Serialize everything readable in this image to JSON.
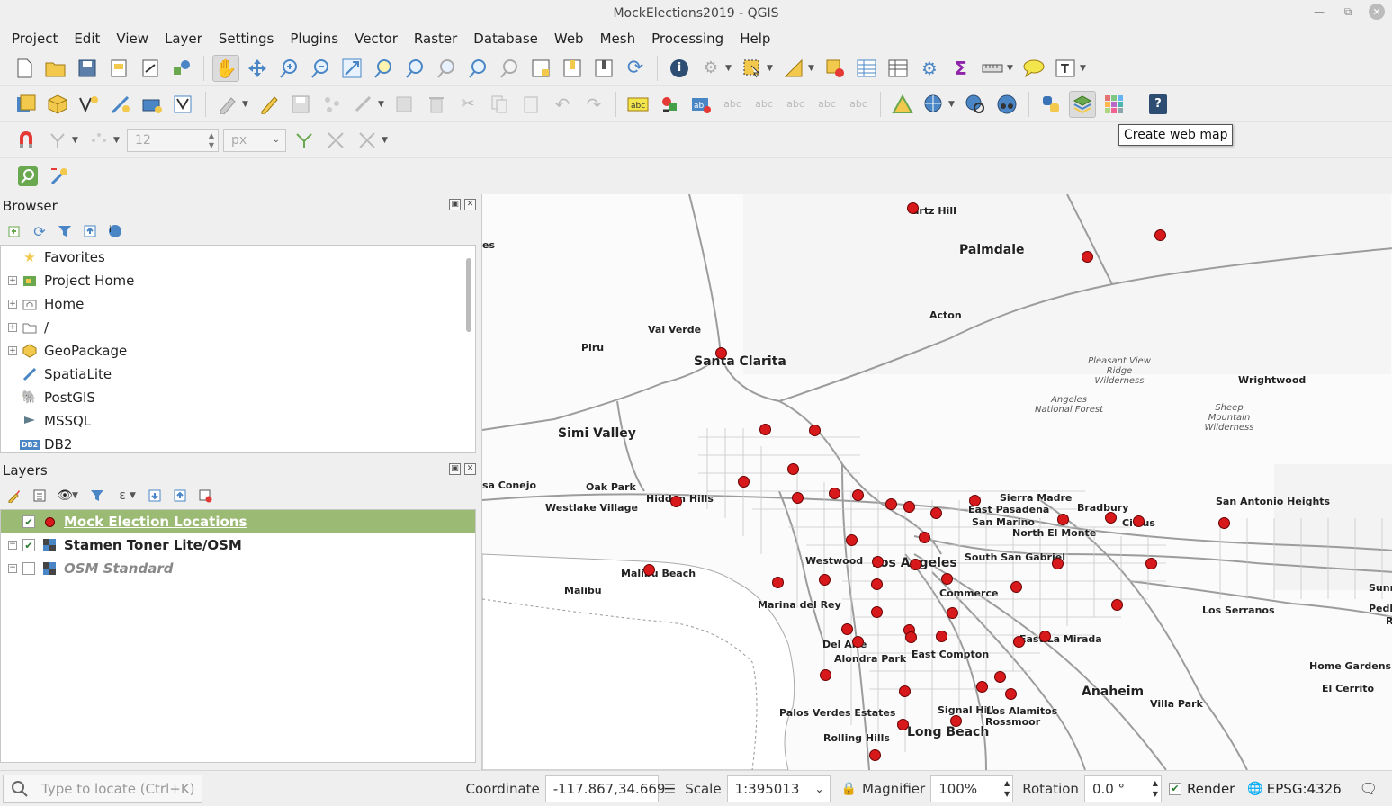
{
  "window": {
    "title": "MockElections2019 - QGIS"
  },
  "menu": [
    "Project",
    "Edit",
    "View",
    "Layer",
    "Settings",
    "Plugins",
    "Vector",
    "Raster",
    "Database",
    "Web",
    "Mesh",
    "Processing",
    "Help"
  ],
  "snapping": {
    "tolerance": "12",
    "unit": "px"
  },
  "tooltip": "Create web map",
  "browser": {
    "title": "Browser",
    "items": [
      {
        "label": "Favorites",
        "expandable": false,
        "icon": "star-icon"
      },
      {
        "label": "Project Home",
        "expandable": true,
        "icon": "project-home-icon"
      },
      {
        "label": "Home",
        "expandable": true,
        "icon": "home-icon"
      },
      {
        "label": "/",
        "expandable": true,
        "icon": "folder-icon"
      },
      {
        "label": "GeoPackage",
        "expandable": true,
        "icon": "geopackage-icon"
      },
      {
        "label": "SpatiaLite",
        "expandable": false,
        "icon": "spatialite-icon"
      },
      {
        "label": "PostGIS",
        "expandable": false,
        "icon": "postgis-icon"
      },
      {
        "label": "MSSQL",
        "expandable": false,
        "icon": "mssql-icon"
      },
      {
        "label": "DB2",
        "expandable": false,
        "icon": "db2-icon"
      }
    ]
  },
  "layers": {
    "title": "Layers",
    "items": [
      {
        "label": "Mock Election Locations",
        "checked": true,
        "selected": true
      },
      {
        "label": "Stamen Toner Lite/OSM",
        "checked": true,
        "selected": false
      },
      {
        "label": "OSM Standard",
        "checked": false,
        "selected": false
      }
    ]
  },
  "map": {
    "labels": [
      {
        "text": "Palmdale",
        "big": true
      },
      {
        "text": "Santa Clarita",
        "big": true
      },
      {
        "text": "Simi Valley",
        "big": true
      },
      {
        "text": "Los Angeles",
        "big": true
      },
      {
        "text": "Long Beach",
        "big": true
      },
      {
        "text": "Anaheim",
        "big": true
      },
      {
        "text": "artz Hill"
      },
      {
        "text": "Acton"
      },
      {
        "text": "Val Verde"
      },
      {
        "text": "Piru"
      },
      {
        "text": "Wrightwood"
      },
      {
        "text": "Oak Park"
      },
      {
        "text": "Hidden Hills"
      },
      {
        "text": "Westlake Village"
      },
      {
        "text": "sa Conejo"
      },
      {
        "text": "Sierra Madre"
      },
      {
        "text": "East Pasadena"
      },
      {
        "text": "Bradbury"
      },
      {
        "text": "San Marino"
      },
      {
        "text": "Citrus"
      },
      {
        "text": "North El Monte"
      },
      {
        "text": "San Antonio Heights"
      },
      {
        "text": "Westwood"
      },
      {
        "text": "South San Gabriel"
      },
      {
        "text": "Malibu Beach"
      },
      {
        "text": "Malibu"
      },
      {
        "text": "Commerce"
      },
      {
        "text": "Marina del Rey"
      },
      {
        "text": "Los Serranos"
      },
      {
        "text": "Del Aire"
      },
      {
        "text": "East La Mirada"
      },
      {
        "text": "Alondra Park"
      },
      {
        "text": "East Compton"
      },
      {
        "text": "Home Gardens"
      },
      {
        "text": "El Cerrito"
      },
      {
        "text": "Palos Verdes Estates"
      },
      {
        "text": "Signal Hill"
      },
      {
        "text": "Los Alamitos"
      },
      {
        "text": "Rossmoor"
      },
      {
        "text": "Villa Park"
      },
      {
        "text": "Rolling Hills"
      },
      {
        "text": "Pedley"
      },
      {
        "text": "Sunn"
      },
      {
        "text": "es"
      },
      {
        "text": "R"
      }
    ],
    "park_labels": [
      {
        "text": "Pleasant View Ridge Wilderness"
      },
      {
        "text": "Angeles National Forest"
      },
      {
        "text": "Sheep Mountain Wilderness"
      }
    ]
  },
  "status": {
    "locate_placeholder": "Type to locate (Ctrl+K)",
    "coordinate_label": "Coordinate",
    "coordinate": "-117.867,34.669",
    "scale_label": "Scale",
    "scale": "1:395013",
    "magnifier_label": "Magnifier",
    "magnifier": "100%",
    "rotation_label": "Rotation",
    "rotation": "0.0 °",
    "render_label": "Render",
    "crs": "EPSG:4326"
  },
  "colors": {
    "selected_layer_bg": "#9bba73",
    "point_fill": "#d7191c",
    "point_stroke": "#6b0000"
  }
}
